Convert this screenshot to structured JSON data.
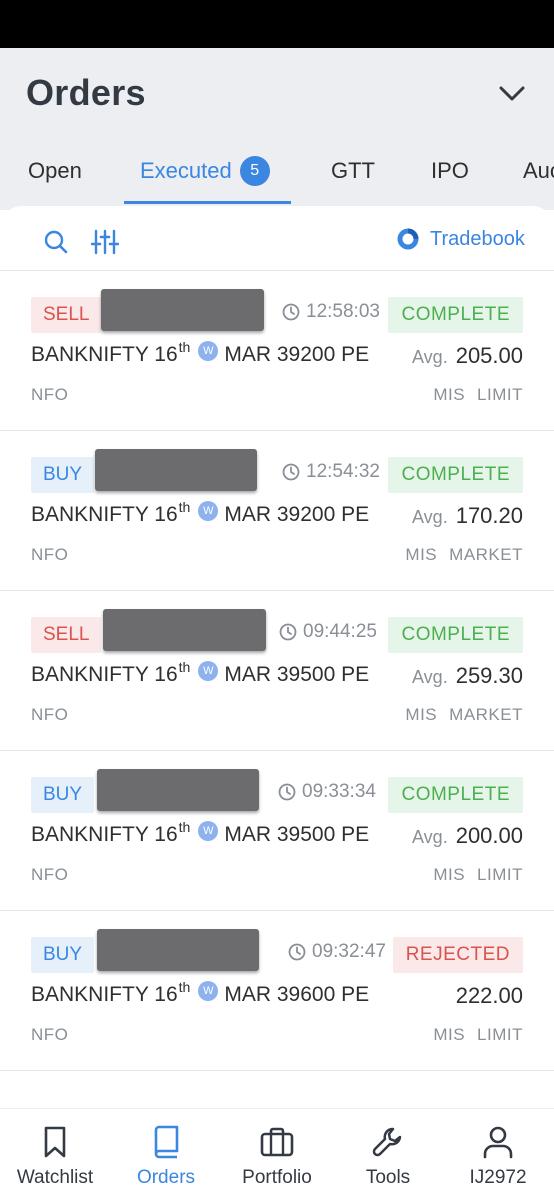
{
  "header": {
    "title": "Orders"
  },
  "tabs": [
    {
      "label": "Open",
      "active": false
    },
    {
      "label": "Executed",
      "active": true,
      "count": "5"
    },
    {
      "label": "GTT",
      "active": false
    },
    {
      "label": "IPO",
      "active": false
    },
    {
      "label": "Auc",
      "active": false
    }
  ],
  "toolbar": {
    "tradebook_label": "Tradebook",
    "search_icon": "search-icon",
    "filter_icon": "sliders-icon"
  },
  "orders": [
    {
      "side": "SELL",
      "time": "12:58:03",
      "status": "COMPLETE",
      "instrument": "BANKNIFTY 16",
      "day_suffix": "th",
      "weekly": "W",
      "instrument_rest": "MAR 39200 PE",
      "avg_label": "Avg.",
      "avg_price": "205.00",
      "exchange": "NFO",
      "product": "MIS",
      "order_type": "LIMIT"
    },
    {
      "side": "BUY",
      "time": "12:54:32",
      "status": "COMPLETE",
      "instrument": "BANKNIFTY 16",
      "day_suffix": "th",
      "weekly": "W",
      "instrument_rest": "MAR 39200 PE",
      "avg_label": "Avg.",
      "avg_price": "170.20",
      "exchange": "NFO",
      "product": "MIS",
      "order_type": "MARKET"
    },
    {
      "side": "SELL",
      "time": "09:44:25",
      "status": "COMPLETE",
      "instrument": "BANKNIFTY 16",
      "day_suffix": "th",
      "weekly": "W",
      "instrument_rest": "MAR 39500 PE",
      "avg_label": "Avg.",
      "avg_price": "259.30",
      "exchange": "NFO",
      "product": "MIS",
      "order_type": "MARKET"
    },
    {
      "side": "BUY",
      "time": "09:33:34",
      "status": "COMPLETE",
      "instrument": "BANKNIFTY 16",
      "day_suffix": "th",
      "weekly": "W",
      "instrument_rest": "MAR 39500 PE",
      "avg_label": "Avg.",
      "avg_price": "200.00",
      "exchange": "NFO",
      "product": "MIS",
      "order_type": "LIMIT"
    },
    {
      "side": "BUY",
      "time": "09:32:47",
      "status": "REJECTED",
      "instrument": "BANKNIFTY 16",
      "day_suffix": "th",
      "weekly": "W",
      "instrument_rest": "MAR 39600 PE",
      "avg_label": "",
      "avg_price": "222.00",
      "exchange": "NFO",
      "product": "MIS",
      "order_type": "LIMIT"
    }
  ],
  "bottom_nav": [
    {
      "label": "Watchlist",
      "icon": "bookmark-icon",
      "active": false
    },
    {
      "label": "Orders",
      "icon": "book-icon",
      "active": true
    },
    {
      "label": "Portfolio",
      "icon": "briefcase-icon",
      "active": false
    },
    {
      "label": "Tools",
      "icon": "wrench-icon",
      "active": false
    },
    {
      "label": "IJ2972",
      "icon": "user-icon",
      "active": false
    }
  ],
  "colors": {
    "accent": "#3a86e0",
    "sell": "#d9534f",
    "buy": "#3a86e0",
    "complete": "#4caf50",
    "rejected": "#d9534f"
  }
}
